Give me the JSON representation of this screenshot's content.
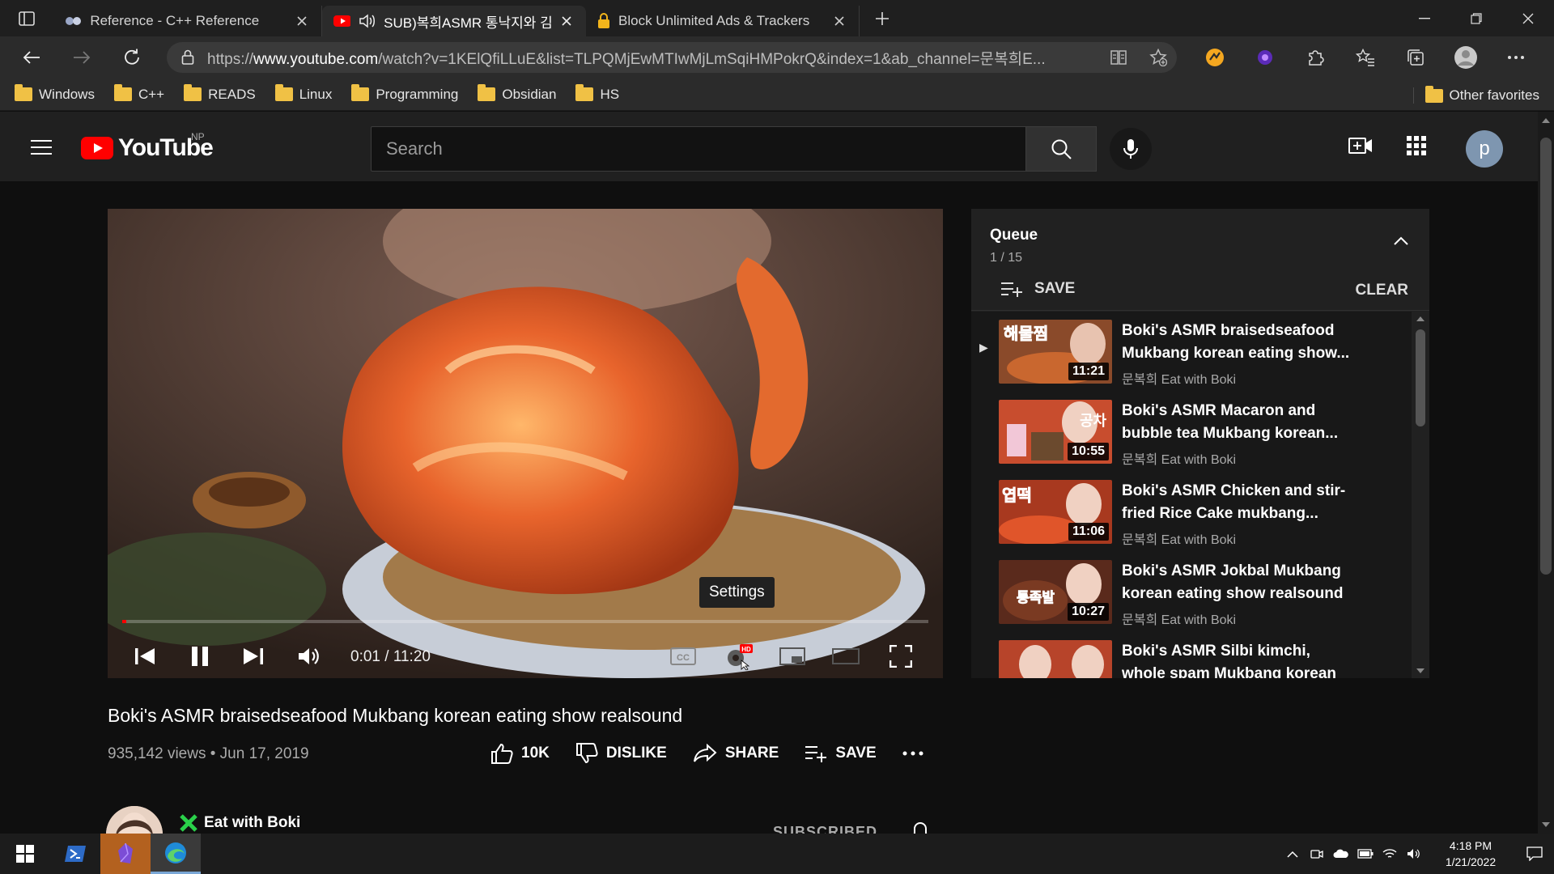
{
  "browser": {
    "tabs": [
      {
        "title": "Reference - C++ Reference",
        "active": false
      },
      {
        "title": "SUB)복희ASMR 통낙지와 김",
        "active": true
      },
      {
        "title": "Block Unlimited Ads & Trackers -",
        "active": false
      }
    ],
    "url_prefix": "https://",
    "url_host": "www.youtube.com",
    "url_path": "/watch?v=1KElQfiLLuE&list=TLPQMjEwMTIwMjLmSqiHMPokrQ&index=1&ab_channel=문복희E...",
    "favorites": [
      "Windows",
      "C++",
      "READS",
      "Linux",
      "Programming",
      "Obsidian",
      "HS"
    ],
    "other_favorites": "Other favorites"
  },
  "youtube": {
    "logo_text": "YouTube",
    "country_code": "NP",
    "search_placeholder": "Search",
    "avatar_letter": "p"
  },
  "player": {
    "time": "0:01 / 11:20",
    "progress": 0.0015,
    "tooltip": "Settings",
    "hd_badge": "HD",
    "cc_label": "CC"
  },
  "video": {
    "title": "Boki's ASMR braisedseafood Mukbang korean eating show realsound",
    "meta": "935,142 views • Jun 17, 2019",
    "likes": "10K",
    "dislike": "DISLIKE",
    "share": "SHARE",
    "save": "SAVE",
    "channel": "Eat with Boki",
    "subscribe": "SUBSCRIBED"
  },
  "queue": {
    "title": "Queue",
    "count": "1 / 15",
    "save": "SAVE",
    "clear": "CLEAR",
    "items": [
      {
        "title": "Boki's ASMR braisedseafood Mukbang korean eating show...",
        "channel": "문복희 Eat with Boki",
        "duration": "11:21",
        "playing": true,
        "thumb_text": "해물찜"
      },
      {
        "title": "Boki's ASMR Macaron and bubble tea Mukbang korean...",
        "channel": "문복희 Eat with Boki",
        "duration": "10:55",
        "playing": false,
        "thumb_text": "공차"
      },
      {
        "title": "Boki's ASMR Chicken and stir-fried Rice Cake mukbang...",
        "channel": "문복희 Eat with Boki",
        "duration": "11:06",
        "playing": false,
        "thumb_text": "엽떡"
      },
      {
        "title": "Boki's ASMR Jokbal Mukbang korean eating show realsound",
        "channel": "문복희 Eat with Boki",
        "duration": "10:27",
        "playing": false,
        "thumb_text": "통족발"
      },
      {
        "title": "Boki's ASMR Silbi kimchi, whole spam Mukbang korean",
        "channel": "",
        "duration": "",
        "playing": false,
        "thumb_text": ""
      }
    ]
  },
  "taskbar": {
    "time": "4:18 PM",
    "date": "1/21/2022"
  },
  "colors": {
    "yt_red": "#ff0000",
    "bg": "#0f0f0f",
    "header": "#202020"
  }
}
